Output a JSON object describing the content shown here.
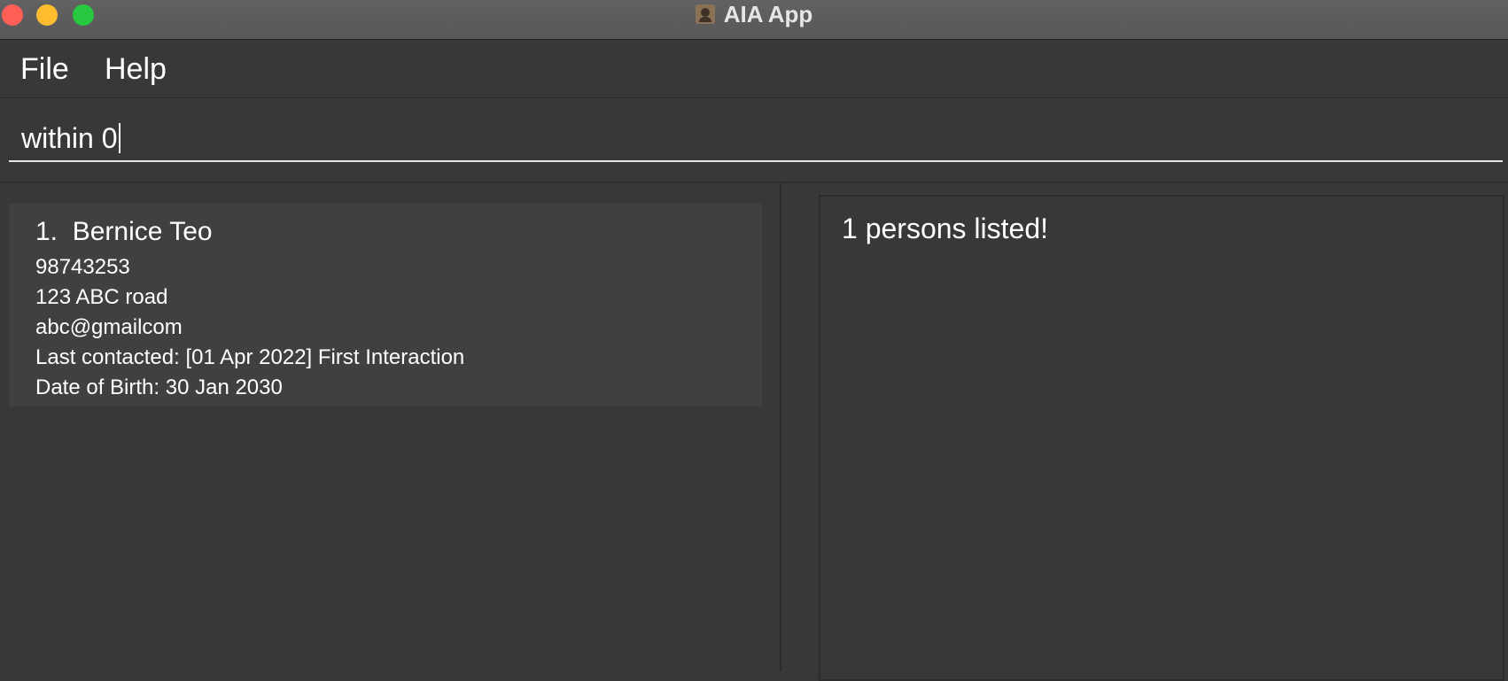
{
  "window": {
    "title": "AIA App",
    "icons": {
      "close": "close-traffic-light",
      "minimize": "minimize-traffic-light",
      "maximize": "maximize-traffic-light",
      "app": "contact-book-icon"
    }
  },
  "menu": {
    "file": "File",
    "help": "Help"
  },
  "command": {
    "value": "within 0"
  },
  "persons": [
    {
      "index": "1.",
      "name": "Bernice Teo",
      "phone": "98743253",
      "address": "123 ABC road",
      "email": "abc@gmailcom",
      "last_contacted": "Last contacted: [01 Apr 2022] First Interaction",
      "birthday": "Date of Birth: 30 Jan 2030"
    }
  ],
  "result": {
    "message": "1 persons listed!"
  },
  "colors": {
    "background": "#383838",
    "card": "#3f4042",
    "text": "#ffffff",
    "close": "#fe5f57",
    "minimize": "#febc2e",
    "maximize": "#28c840"
  }
}
